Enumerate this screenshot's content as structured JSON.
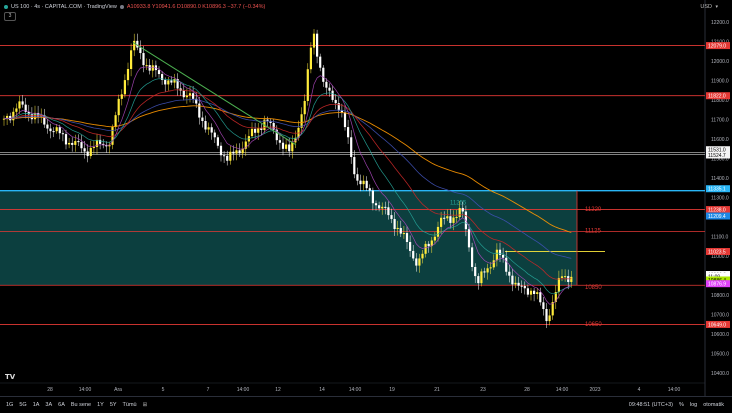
{
  "header": {
    "symbol": "US 100 · 4s · CAPITAL.COM · TradingView",
    "ohlc": "A10933.8  Y10941.6  D10890.0  K10896.3  −37.7 (−0.34%)",
    "collapse_label": "3",
    "currency": "USD",
    "dot_colors": [
      "#26a69a",
      "#787b86"
    ]
  },
  "price_axis": {
    "ticks": [
      "12200.0",
      "12100.0",
      "12000.0",
      "11900.0",
      "11800.0",
      "11700.0",
      "11600.0",
      "11500.0",
      "11400.0",
      "11300.0",
      "11200.0",
      "11100.0",
      "11000.0",
      "10900.0",
      "10800.0",
      "10700.0",
      "10600.0",
      "10500.0",
      "10400.0"
    ],
    "tags": [
      {
        "text": "12079.0",
        "color": "#e53935"
      },
      {
        "text": "11822.0",
        "color": "#e53935"
      },
      {
        "text": "11531.0",
        "color": "#f5f5f5"
      },
      {
        "text": "11524.7",
        "color": "#f5f5f5"
      },
      {
        "text": "11335.1",
        "color": "#29b6f6"
      },
      {
        "text": "11238.0",
        "color": "#e53935"
      },
      {
        "text": "11209.4",
        "color": "#1e88e5"
      },
      {
        "text": "11023.5",
        "color": "#e53935"
      },
      {
        "text": "10896.3",
        "color": "#ffffff"
      },
      {
        "text": "11:09",
        "color": "#ffffff"
      },
      {
        "text": "10886.4",
        "color": "#aeea00"
      },
      {
        "text": "10876.9",
        "color": "#e040fb"
      },
      {
        "text": "10649.0",
        "color": "#e53935"
      }
    ]
  },
  "time_axis": {
    "labels": [
      "28",
      "14:00",
      "Ara",
      "5",
      "7",
      "14:00",
      "12",
      "14",
      "14:00",
      "19",
      "21",
      "23",
      "28",
      "14:00",
      "2023",
      "4",
      "14:00"
    ]
  },
  "levels": {
    "a": "11255",
    "b": "11220",
    "c": "11125",
    "d": "10850",
    "e": "10650"
  },
  "bottom_bar": {
    "ranges": [
      "1G",
      "5G",
      "1A",
      "3A",
      "6A",
      "Bu sene",
      "1Y",
      "5Y",
      "Tümü"
    ],
    "clock": "09:48:51 (UTC+3)",
    "percent": "%",
    "log": "log",
    "auto": "otomatik"
  },
  "colors": {
    "background": "#000000",
    "bull_candle": "#ffeb3b",
    "bear_candle": "#ffffff",
    "zone_fill": "#0e4a4a",
    "resistance": "#e53935",
    "trendline": "#4caf50",
    "ema_orange": "#ff9800",
    "ema_blue": "#3f51b5",
    "ema_red": "#c62828",
    "ema_teal": "#26a69a",
    "ema_purple": "#ab47bc"
  }
}
